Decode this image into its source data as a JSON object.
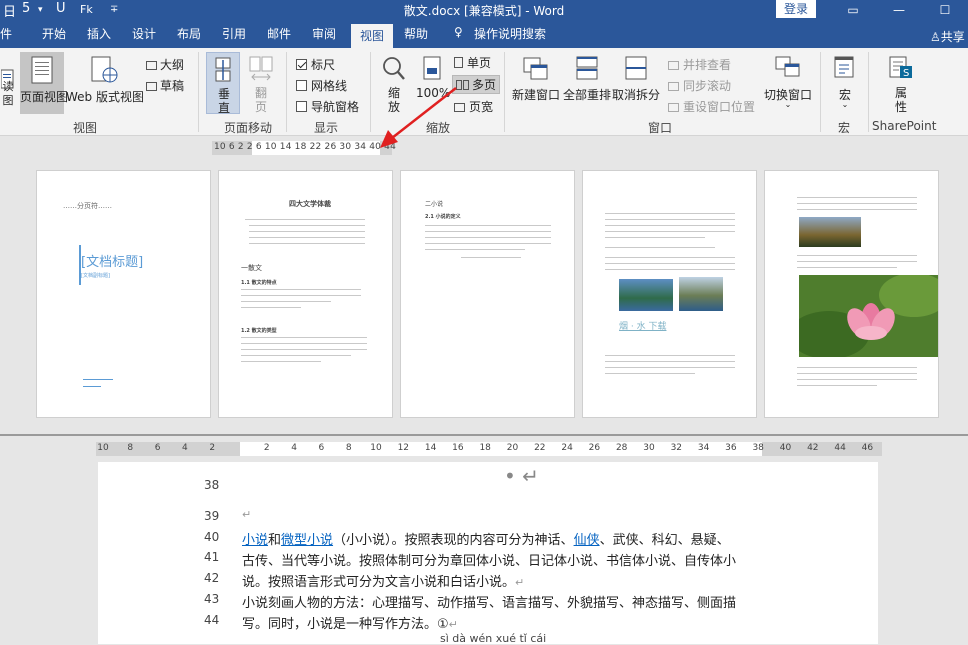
{
  "titlebar": {
    "title": "散文.docx [兼容模式] - Word",
    "login": "登录",
    "qa_save": "日",
    "qa_undo": "5",
    "qa_redo": "U",
    "qa_touch": "Fk",
    "qa_more": "∓"
  },
  "tabs": [
    "件",
    "开始",
    "插入",
    "设计",
    "布局",
    "引用",
    "邮件",
    "审阅",
    "视图",
    "帮助",
    "操作说明搜索"
  ],
  "share": "共享",
  "ribbon": {
    "view_group": {
      "read": "读\n图",
      "page_view": "页面视图",
      "web_view": "Web 版式视图",
      "outline": "大纲",
      "draft": "草稿",
      "label": "视图"
    },
    "page_move_group": {
      "vertical": "垂\n直",
      "side": "翻\n页",
      "label": "页面移动"
    },
    "show_group": {
      "ruler": "标尺",
      "gridlines": "网格线",
      "nav_pane": "导航窗格",
      "label": "显示"
    },
    "zoom_group": {
      "zoom": "缩\n放",
      "hundred": "100%",
      "one_page": "单页",
      "multi_page": "多页",
      "page_width": "页宽",
      "label": "缩放"
    },
    "window_group": {
      "new_window": "新建窗口",
      "arrange_all": "全部重排",
      "split": "取消拆分",
      "side_by_side": "并排查看",
      "sync_scroll": "同步滚动",
      "reset_pos": "重设窗口位置",
      "switch_window": "切换窗口",
      "label": "窗口"
    },
    "macro_group": {
      "macros": "宏",
      "label": "宏"
    },
    "sp_group": {
      "props": "属\n性",
      "label": "SharePoint"
    }
  },
  "ruler_top": "10  6   2  2   6  10  14  18  22  26  30  34     40  44",
  "ruler_bottom": [
    "10",
    "8",
    "6",
    "4",
    "2",
    "",
    "2",
    "4",
    "6",
    "8",
    "10",
    "12",
    "14",
    "16",
    "18",
    "20",
    "22",
    "24",
    "26",
    "28",
    "30",
    "32",
    "34",
    "36",
    "38",
    "40",
    "42",
    "44",
    "46"
  ],
  "pages": {
    "p1": {
      "break": "……分页符……",
      "doc_title": "[文档标题]",
      "small": "[文档副标题]"
    },
    "p2": {
      "title": "四大文学体裁",
      "section": "一散文",
      "h1": "1.1 散文的特点",
      "h2": "1.2 散文的类型"
    },
    "p3": {
      "title": "二小说",
      "h1": "2.1 小说的定义"
    },
    "p4": {
      "caption": "烟 · 水 下载"
    },
    "p5": {}
  },
  "doc": {
    "line_numbers": [
      "38",
      "39",
      "40",
      "41",
      "42",
      "43",
      "44"
    ],
    "lines": [
      {
        "segments": [
          {
            "t": "小说",
            "link": true
          },
          {
            "t": "和"
          },
          {
            "t": "微型小说",
            "link": true
          },
          {
            "t": "（小小说）。按照表现的内容可分为神话、"
          },
          {
            "t": "仙侠",
            "link": true
          },
          {
            "t": "、武侠、科幻、悬疑、"
          }
        ]
      },
      {
        "segments": [
          {
            "t": "古传、当代等小说。按照体制可分为章回体小说、日记体小说、书信体小说、自传体小"
          }
        ]
      },
      {
        "segments": [
          {
            "t": "说。按照语言形式可分为文言小说和白话小说。"
          }
        ]
      },
      {
        "segments": [
          {
            "t": "小说刻画人物的方法：心理描写、动作描写、语言描写、外貌描写、神态描写、侧面描"
          }
        ]
      },
      {
        "segments": [
          {
            "t": "写。同时，小说是一种写作方法。①"
          }
        ]
      }
    ],
    "pinyin": "sì   dà   wén  xué  tǐ   cái"
  }
}
